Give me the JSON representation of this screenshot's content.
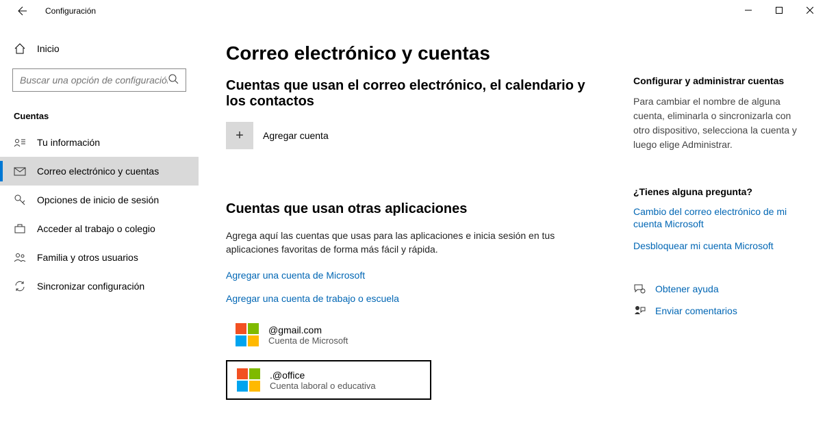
{
  "window": {
    "title": "Configuración"
  },
  "sidebar": {
    "home_label": "Inicio",
    "search_placeholder": "Buscar una opción de configuración",
    "category": "Cuentas",
    "items": [
      {
        "label": "Tu información"
      },
      {
        "label": "Correo electrónico y cuentas"
      },
      {
        "label": "Opciones de inicio de sesión"
      },
      {
        "label": "Acceder al trabajo o colegio"
      },
      {
        "label": "Familia y otros usuarios"
      },
      {
        "label": "Sincronizar configuración"
      }
    ]
  },
  "main": {
    "title": "Correo electrónico y cuentas",
    "section1_title": "Cuentas que usan el correo electrónico, el calendario y los contactos",
    "add_account_label": "Agregar cuenta",
    "section2_title": "Cuentas que usan otras aplicaciones",
    "section2_description": "Agrega aquí las cuentas que usas para las aplicaciones e inicia sesión en tus aplicaciones favoritas de forma más fácil y rápida.",
    "link_add_ms": "Agregar una cuenta de Microsoft",
    "link_add_work": "Agregar una cuenta de trabajo o escuela",
    "accounts": [
      {
        "email": "@gmail.com",
        "type": "Cuenta de Microsoft"
      },
      {
        "email": ".@office",
        "type": "Cuenta laboral o educativa"
      }
    ]
  },
  "right": {
    "manage_heading": "Configurar y administrar cuentas",
    "manage_text": "Para cambiar el nombre de alguna cuenta, eliminarla o sincronizarla con otro dispositivo, selecciona la cuenta y luego elige Administrar.",
    "question_heading": "¿Tienes alguna pregunta?",
    "link_change_email": "Cambio del correo electrónico de mi cuenta Microsoft",
    "link_unlock": "Desbloquear mi cuenta Microsoft",
    "help_label": "Obtener ayuda",
    "feedback_label": "Enviar comentarios"
  }
}
